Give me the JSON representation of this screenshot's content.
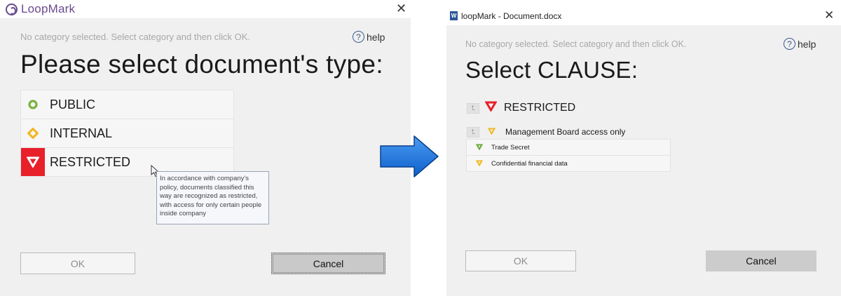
{
  "left_dialog": {
    "app_name": "LoopMark",
    "close_symbol": "✕",
    "hint": "No category selected. Select category and then click OK.",
    "help_symbol": "?",
    "help_label": "help",
    "title": "Please select document's type:",
    "options": [
      {
        "label": "PUBLIC",
        "icon": "circle-green-icon",
        "color": "#7ab33a"
      },
      {
        "label": "INTERNAL",
        "icon": "diamond-yellow-icon",
        "color": "#f2b824"
      },
      {
        "label": "RESTRICTED",
        "icon": "triangle-red-icon",
        "color": "#e8202a"
      }
    ],
    "tooltip": "In accordance with company's policy, documents classified this way are recognized as restricted, with access for only certain people inside company",
    "ok_label": "OK",
    "cancel_label": "Cancel"
  },
  "arrow": {
    "color": "#1a6fd6",
    "icon": "right-arrow-icon"
  },
  "right_dialog": {
    "window_title": "loopMark - Document.docx",
    "word_icon_letter": "W",
    "close_symbol": "✕",
    "hint": "No category selected. Select category and then click OK.",
    "help_symbol": "?",
    "help_label": "help",
    "title": "Select CLAUSE:",
    "up_symbol": "⮤",
    "clauses": {
      "restricted": {
        "label": "RESTRICTED",
        "color": "#e8202a"
      },
      "management": {
        "label": "Management Board access only",
        "color": "#f2b824"
      },
      "subitems": [
        {
          "label": "Trade Secret",
          "color": "#6aa832"
        },
        {
          "label": "Confidential financial data",
          "color": "#f2b824"
        }
      ]
    },
    "ok_label": "OK",
    "cancel_label": "Cancel"
  }
}
